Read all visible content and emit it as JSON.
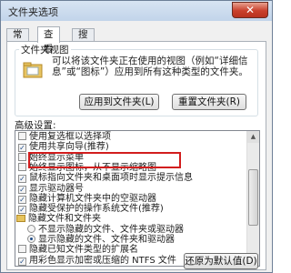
{
  "window": {
    "title": "文件夹选项",
    "close_label": "✕"
  },
  "tabs": [
    {
      "label": "常规",
      "active": false
    },
    {
      "label": "查看",
      "active": true
    },
    {
      "label": "搜索",
      "active": false
    }
  ],
  "folder_view": {
    "group_title": "文件夹视图",
    "description_line1": "可以将该文件夹正在使用的视图（例如“详细信",
    "description_line2": "息”或“图标”）应用到所有这种类型的文件夹。",
    "apply_button": "应用到文件夹(L)",
    "reset_button": "重置文件夹(R)"
  },
  "advanced": {
    "label": "高级设置:",
    "items": [
      {
        "kind": "checkbox",
        "label": "使用复选框以选择项",
        "checked": false
      },
      {
        "kind": "checkbox",
        "label": "使用共享向导(推荐)",
        "checked": true
      },
      {
        "kind": "checkbox",
        "label": "始终显示菜单",
        "checked": false
      },
      {
        "kind": "checkbox",
        "label": "始终显示图标，从不显示缩略图",
        "checked": false
      },
      {
        "kind": "checkbox",
        "label": "鼠标指向文件夹和桌面项时显示提示信息",
        "checked": true
      },
      {
        "kind": "checkbox",
        "label": "显示驱动器号",
        "checked": true
      },
      {
        "kind": "checkbox",
        "label": "隐藏计算机文件夹中的空驱动器",
        "checked": true
      },
      {
        "kind": "checkbox",
        "label": "隐藏受保护的操作系统文件(推荐)",
        "checked": true
      },
      {
        "kind": "folder",
        "label": "隐藏文件和文件夹"
      },
      {
        "kind": "radio",
        "label": "不显示隐藏的文件、文件夹或驱动器",
        "checked": false
      },
      {
        "kind": "radio",
        "label": "显示隐藏的文件、文件夹和驱动器",
        "checked": true
      },
      {
        "kind": "checkbox",
        "label": "隐藏已知文件类型的扩展名",
        "checked": false
      },
      {
        "kind": "checkbox",
        "label": "用彩色显示加密或压缩的 NTFS 文件",
        "checked": true
      }
    ]
  },
  "restore_button": "还原为默认值(D)",
  "scroll_up": "▲",
  "scroll_down": "▼",
  "check_mark": "✓",
  "colors": {
    "highlight_box": "#d21d1d",
    "title_bar": "#c2d4ea",
    "close_button": "#c9402c"
  }
}
